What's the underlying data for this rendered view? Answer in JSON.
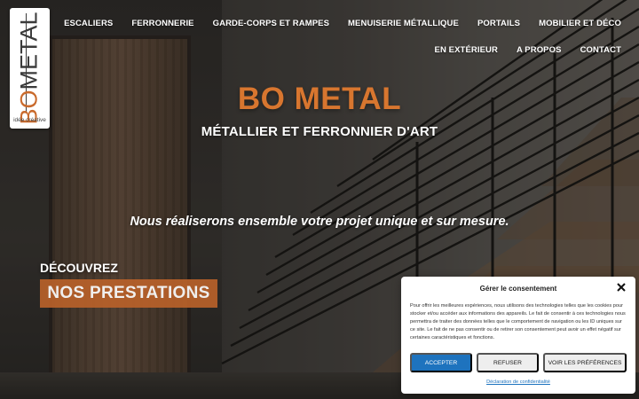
{
  "logo": {
    "brand_bo": "BO",
    "brand_metal": "METAL",
    "tag": "idée créative"
  },
  "nav": {
    "row1": [
      "ESCALIERS",
      "FERRONNERIE",
      "GARDE-CORPS ET RAMPES",
      "MENUISERIE MÉTALLIQUE",
      "PORTAILS",
      "MOBILIER ET DÉCO"
    ],
    "row2": [
      "EN EXTÉRIEUR",
      "A PROPOS",
      "CONTACT"
    ]
  },
  "hero": {
    "title": "BO METAL",
    "subtitle": "MÉTALLIER ET FERRONNIER D'ART",
    "tagline": "Nous réaliserons ensemble votre projet unique et sur mesure.",
    "discover": "DÉCOUVREZ",
    "services_button": "NOS PRESTATIONS"
  },
  "cookie": {
    "title": "Gérer le consentement",
    "text": "Pour offrir les meilleures expériences, nous utilisons des technologies telles que les cookies pour stocker et/ou accéder aux informations des appareils. Le fait de consentir à ces technologies nous permettra de traiter des données telles que le comportement de navigation ou les ID uniques sur ce site. Le fait de ne pas consentir ou de retirer son consentement peut avoir un effet négatif sur certaines caractéristiques et fonctions.",
    "accept": "ACCEPTER",
    "refuse": "REFUSER",
    "preferences": "VOIR LES PRÉFÉRENCES",
    "privacy_link": "Déclaration de confidentialité"
  },
  "colors": {
    "accent_orange": "#d8762f",
    "button_orange": "#b8612a",
    "accept_blue": "#1e73be"
  }
}
